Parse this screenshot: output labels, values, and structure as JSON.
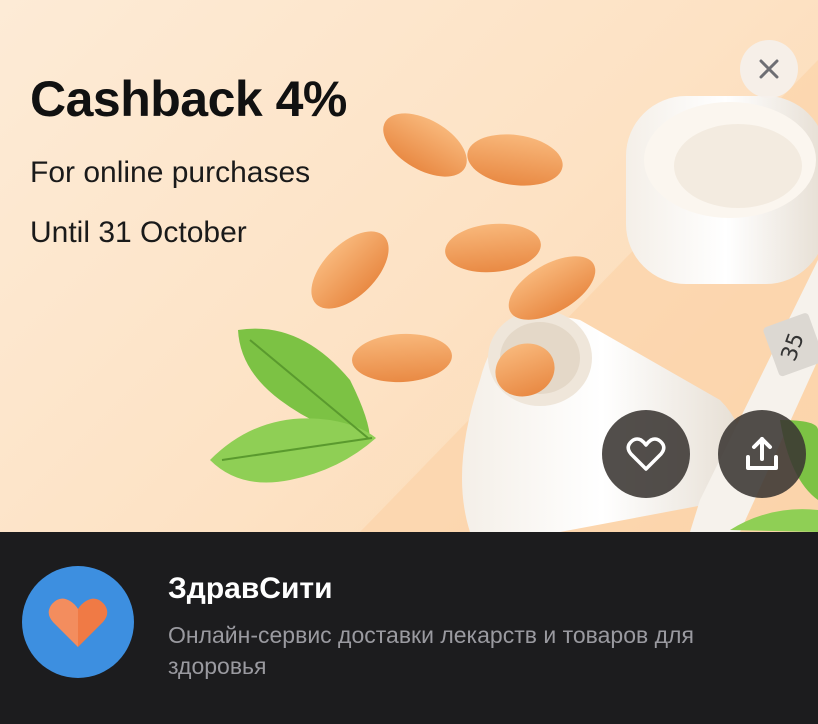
{
  "promo": {
    "title": "Cashback 4%",
    "subtitle": "For online purchases",
    "validity": "Until 31 October"
  },
  "controls": {
    "close_icon": "close-icon",
    "favorite_icon": "heart-outline-icon",
    "share_icon": "share-upload-icon"
  },
  "merchant": {
    "name": "ЗдравСити",
    "description": "Онлайн-сервис доставки лекарств и товаров для здоровья",
    "logo_icon": "heart-logo-icon"
  },
  "colors": {
    "hero_bg": "#fde2c4",
    "pill": "#f2a05c",
    "panel_bg": "#1c1c1e",
    "logo_bg": "#3d8fe0",
    "logo_heart": "#f07a45"
  }
}
